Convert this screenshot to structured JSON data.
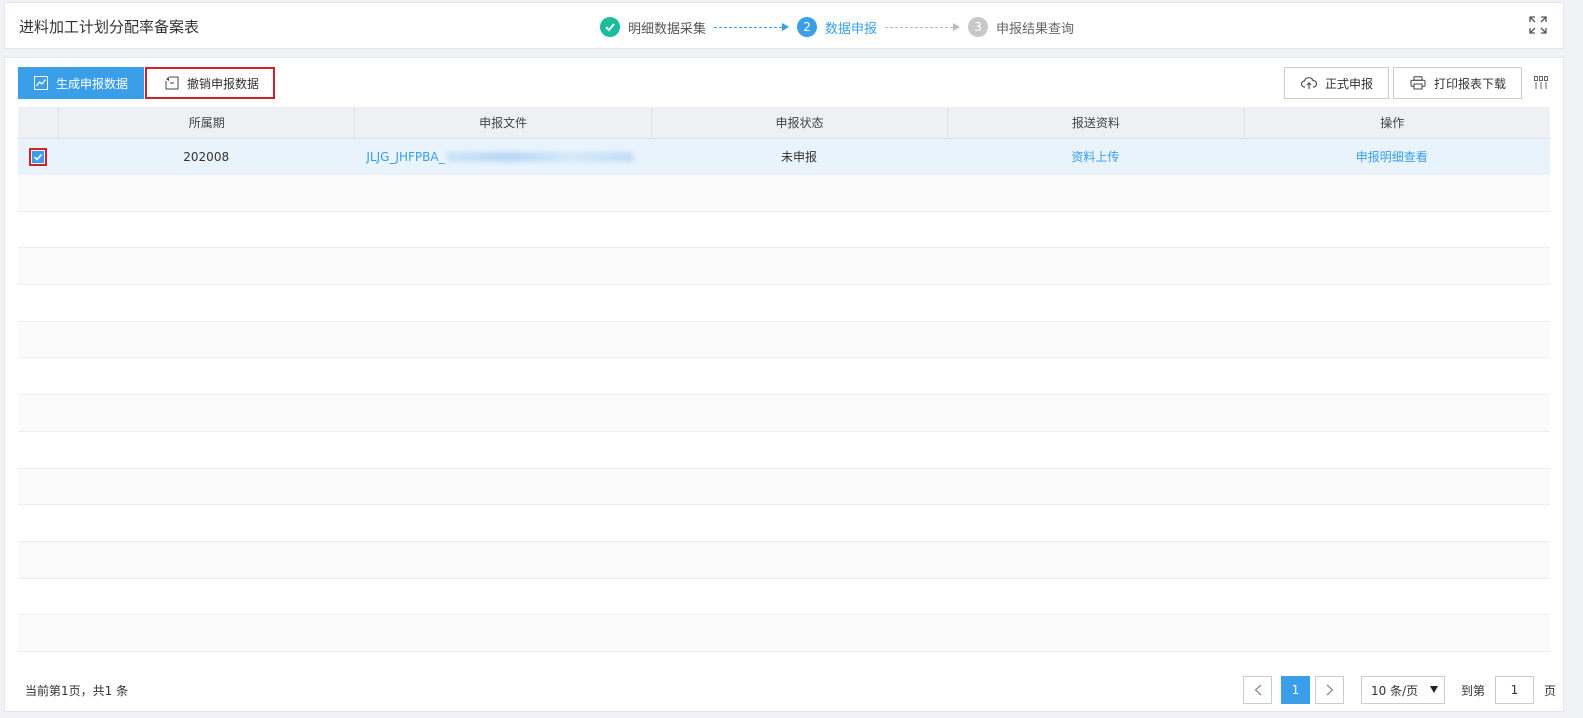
{
  "header": {
    "title": "进料加工计划分配率备案表",
    "steps": [
      {
        "num": "",
        "label": "明细数据采集",
        "state": "done"
      },
      {
        "num": "2",
        "label": "数据申报",
        "state": "active"
      },
      {
        "num": "3",
        "label": "申报结果查询",
        "state": "pending"
      }
    ]
  },
  "toolbar": {
    "generate_label": "生成申报数据",
    "revoke_label": "撤销申报数据",
    "submit_label": "正式申报",
    "print_label": "打印报表下载"
  },
  "table": {
    "columns": [
      "所属期",
      "申报文件",
      "申报状态",
      "报送资料",
      "操作"
    ],
    "rows": [
      {
        "period": "202008",
        "file": "JLJG_JHFPBA_",
        "status": "未申报",
        "material": "资料上传",
        "action": "申报明细查看",
        "checked": true
      }
    ]
  },
  "footer": {
    "summary": "当前第1页，共1 条",
    "current_page": "1",
    "page_size": "10 条/页",
    "goto_label": "到第",
    "goto_value": "1",
    "goto_suffix": "页"
  },
  "colors": {
    "primary": "#3a9fe8",
    "success": "#1bbc9b",
    "highlight_border": "#d0202e"
  },
  "icons": {
    "step_done": "check-icon",
    "fullscreen": "expand-icon",
    "generate": "chart-icon",
    "revoke": "undo-doc-icon",
    "submit": "cloud-upload-icon",
    "print": "printer-icon",
    "columns": "grid-icon"
  }
}
